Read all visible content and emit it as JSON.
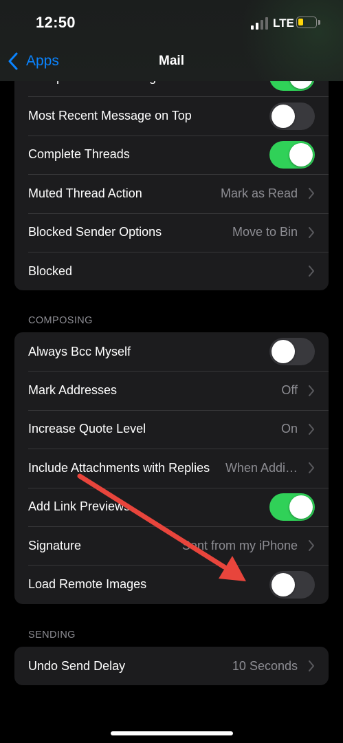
{
  "status_bar": {
    "time": "12:50",
    "network": "LTE"
  },
  "nav": {
    "back_label": "Apps",
    "title": "Mail"
  },
  "scrolled_row_label": "Collapse Read Messages",
  "threading_group": {
    "rows": [
      {
        "label": "Most Recent Message on Top",
        "type": "toggle",
        "on": false
      },
      {
        "label": "Complete Threads",
        "type": "toggle",
        "on": true
      },
      {
        "label": "Muted Thread Action",
        "type": "link",
        "value": "Mark as Read"
      },
      {
        "label": "Blocked Sender Options",
        "type": "link",
        "value": "Move to Bin"
      },
      {
        "label": "Blocked",
        "type": "link",
        "value": ""
      }
    ]
  },
  "composing": {
    "header": "COMPOSING",
    "rows": [
      {
        "label": "Always Bcc Myself",
        "type": "toggle",
        "on": false
      },
      {
        "label": "Mark Addresses",
        "type": "link",
        "value": "Off"
      },
      {
        "label": "Increase Quote Level",
        "type": "link",
        "value": "On"
      },
      {
        "label": "Include Attachments with Replies",
        "type": "link",
        "value": "When Addi…"
      },
      {
        "label": "Add Link Previews",
        "type": "toggle",
        "on": true
      },
      {
        "label": "Signature",
        "type": "link",
        "value": "Sent from my iPhone"
      },
      {
        "label": "Load Remote Images",
        "type": "toggle",
        "on": false
      }
    ]
  },
  "sending": {
    "header": "SENDING",
    "rows": [
      {
        "label": "Undo Send Delay",
        "type": "link",
        "value": "10 Seconds"
      }
    ]
  },
  "colors": {
    "background": "#000000",
    "cell": "#1c1c1e",
    "accent_blue": "#0a84ff",
    "toggle_on": "#30d158",
    "toggle_off": "#39393d",
    "secondary_text": "#8d8d93",
    "battery": "#ffd60a",
    "annotation_arrow": "#e8453c"
  }
}
